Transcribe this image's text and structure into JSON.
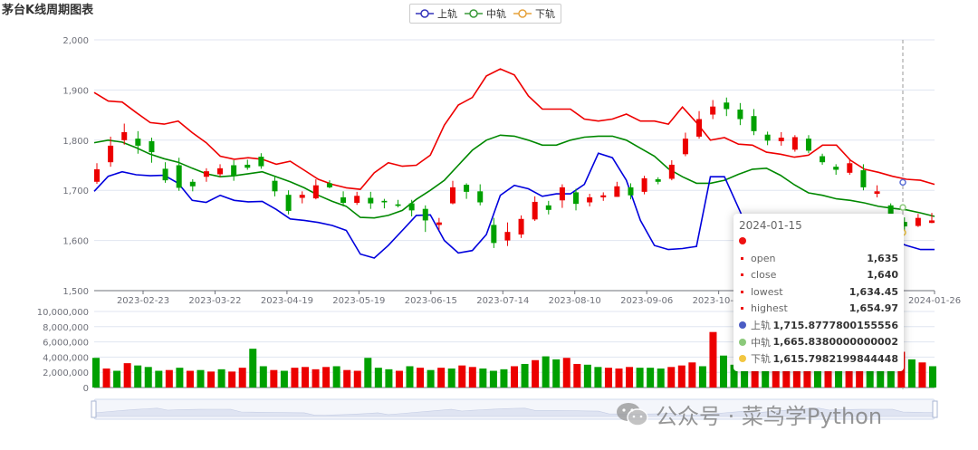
{
  "title": "茅台K线周期图表",
  "legend": [
    {
      "name": "上轨",
      "color": "#3333bb"
    },
    {
      "name": "中轨",
      "color": "#3a9a3a"
    },
    {
      "name": "下轨",
      "color": "#e6a23c"
    }
  ],
  "chart_data": [
    {
      "type": "candlestick",
      "subtype": "bollinger",
      "title": "茅台K线周期图表",
      "ylim": [
        1500,
        2000
      ],
      "yticks": [
        "1,500",
        "1,600",
        "1,700",
        "1,800",
        "1,900",
        "2,000"
      ],
      "xticks": [
        "2023-02-23",
        "2023-03-22",
        "2023-04-19",
        "2023-05-19",
        "2023-06-15",
        "2023-07-14",
        "2023-08-10",
        "2023-09-06",
        "2023-10-11",
        "2023-11-07",
        "2023-12-05",
        "2024-01-26"
      ],
      "colors": {
        "up": "#ec0000",
        "down": "#00a000",
        "upper": "#ee0000",
        "middle": "#008800",
        "lower": "#0000dd"
      },
      "upper": [
        1895,
        1878,
        1876,
        1855,
        1835,
        1832,
        1838,
        1815,
        1795,
        1768,
        1762,
        1765,
        1762,
        1752,
        1758,
        1740,
        1722,
        1712,
        1705,
        1702,
        1735,
        1755,
        1748,
        1750,
        1770,
        1830,
        1870,
        1885,
        1928,
        1942,
        1930,
        1888,
        1862,
        1862,
        1862,
        1842,
        1838,
        1842,
        1852,
        1838,
        1838,
        1832,
        1866,
        1835,
        1800,
        1805,
        1792,
        1790,
        1776,
        1772,
        1766,
        1770,
        1790,
        1790,
        1760,
        1742,
        1736,
        1728,
        1722,
        1720,
        1712
      ],
      "middle": [
        1795,
        1800,
        1796,
        1785,
        1772,
        1763,
        1756,
        1744,
        1733,
        1727,
        1729,
        1733,
        1737,
        1727,
        1717,
        1705,
        1690,
        1678,
        1668,
        1646,
        1645,
        1650,
        1660,
        1682,
        1700,
        1720,
        1750,
        1780,
        1800,
        1810,
        1808,
        1800,
        1790,
        1790,
        1800,
        1806,
        1808,
        1808,
        1800,
        1784,
        1768,
        1743,
        1727,
        1714,
        1714,
        1720,
        1732,
        1742,
        1744,
        1730,
        1711,
        1695,
        1690,
        1683,
        1680,
        1675,
        1668,
        1664,
        1661,
        1655,
        1648
      ],
      "lower": [
        1698,
        1728,
        1737,
        1731,
        1729,
        1730,
        1714,
        1680,
        1676,
        1690,
        1680,
        1677,
        1678,
        1662,
        1643,
        1640,
        1636,
        1630,
        1620,
        1573,
        1565,
        1590,
        1620,
        1650,
        1651,
        1600,
        1575,
        1580,
        1612,
        1690,
        1710,
        1703,
        1688,
        1693,
        1693,
        1712,
        1774,
        1765,
        1720,
        1640,
        1590,
        1582,
        1584,
        1588,
        1727,
        1727,
        1665,
        1603,
        1593,
        1600,
        1605,
        1610,
        1612,
        1606,
        1604,
        1619,
        1605,
        1600,
        1590,
        1582,
        1582
      ],
      "candles": [
        [
          1717,
          1742,
          1754,
          1713
        ],
        [
          1756,
          1789,
          1807,
          1747
        ],
        [
          1800,
          1816,
          1833,
          1791
        ],
        [
          1803,
          1789,
          1818,
          1773
        ],
        [
          1798,
          1776,
          1805,
          1755
        ],
        [
          1743,
          1720,
          1756,
          1715
        ],
        [
          1750,
          1705,
          1765,
          1699
        ],
        [
          1717,
          1708,
          1722,
          1698
        ],
        [
          1727,
          1738,
          1744,
          1717
        ],
        [
          1732,
          1744,
          1752,
          1727
        ],
        [
          1750,
          1729,
          1760,
          1719
        ],
        [
          1751,
          1745,
          1761,
          1741
        ],
        [
          1767,
          1748,
          1774,
          1743
        ],
        [
          1719,
          1698,
          1728,
          1688
        ],
        [
          1691,
          1659,
          1700,
          1652
        ],
        [
          1685,
          1691,
          1698,
          1674
        ],
        [
          1684,
          1710,
          1722,
          1682
        ],
        [
          1714,
          1706,
          1720,
          1704
        ],
        [
          1686,
          1675,
          1698,
          1668
        ],
        [
          1675,
          1689,
          1697,
          1671
        ],
        [
          1685,
          1674,
          1697,
          1663
        ],
        [
          1679,
          1676,
          1683,
          1664
        ],
        [
          1672,
          1669,
          1681,
          1666
        ],
        [
          1674,
          1660,
          1681,
          1648
        ],
        [
          1663,
          1640,
          1670,
          1617
        ],
        [
          1631,
          1636,
          1645,
          1621
        ],
        [
          1674,
          1706,
          1719,
          1672
        ],
        [
          1711,
          1697,
          1714,
          1683
        ],
        [
          1698,
          1676,
          1712,
          1670
        ],
        [
          1631,
          1595,
          1645,
          1585
        ],
        [
          1600,
          1617,
          1636,
          1589
        ],
        [
          1612,
          1643,
          1650,
          1605
        ],
        [
          1642,
          1677,
          1688,
          1639
        ],
        [
          1670,
          1661,
          1679,
          1652
        ],
        [
          1680,
          1706,
          1712,
          1665
        ],
        [
          1696,
          1673,
          1703,
          1660
        ],
        [
          1676,
          1686,
          1693,
          1668
        ],
        [
          1686,
          1690,
          1696,
          1679
        ],
        [
          1687,
          1708,
          1717,
          1687
        ],
        [
          1706,
          1690,
          1714,
          1682
        ],
        [
          1697,
          1724,
          1729,
          1692
        ],
        [
          1722,
          1717,
          1726,
          1712
        ],
        [
          1723,
          1751,
          1760,
          1720
        ],
        [
          1772,
          1803,
          1815,
          1768
        ],
        [
          1807,
          1842,
          1858,
          1803
        ],
        [
          1851,
          1867,
          1880,
          1842
        ],
        [
          1875,
          1862,
          1885,
          1848
        ],
        [
          1861,
          1842,
          1874,
          1830
        ],
        [
          1848,
          1818,
          1862,
          1810
        ],
        [
          1811,
          1799,
          1817,
          1790
        ],
        [
          1798,
          1805,
          1816,
          1789
        ],
        [
          1781,
          1806,
          1810,
          1777
        ],
        [
          1803,
          1779,
          1810,
          1774
        ],
        [
          1768,
          1756,
          1773,
          1751
        ],
        [
          1747,
          1741,
          1752,
          1731
        ],
        [
          1735,
          1754,
          1762,
          1731
        ],
        [
          1740,
          1706,
          1752,
          1700
        ],
        [
          1693,
          1698,
          1710,
          1686
        ],
        [
          1670,
          1635,
          1674,
          1629
        ],
        [
          1637,
          1628,
          1646,
          1621
        ],
        [
          1629,
          1645,
          1653,
          1627
        ],
        [
          1635,
          1640,
          1654.97,
          1634.45
        ]
      ]
    },
    {
      "type": "bar",
      "title": "volume",
      "ylim": [
        0,
        10000000
      ],
      "yticks": [
        "0",
        "2,000,000",
        "4,000,000",
        "6,000,000",
        "8,000,000",
        "10,000,000"
      ],
      "values": [
        3900000,
        2500000,
        2200000,
        3200000,
        2900000,
        2700000,
        2200000,
        2300000,
        2600000,
        2200000,
        2300000,
        2100000,
        2400000,
        2100000,
        2600000,
        5100000,
        2800000,
        2300000,
        2200000,
        2600000,
        2700000,
        2400000,
        2700000,
        2800000,
        2300000,
        2200000,
        3900000,
        2600000,
        2400000,
        2200000,
        2800000,
        2600000,
        2300000,
        2600000,
        2500000,
        2900000,
        2700000,
        2500000,
        2200000,
        2400000,
        2800000,
        3100000,
        3600000,
        4100000,
        3700000,
        3900000,
        3100000,
        3000000,
        2700000,
        2600000,
        2500000,
        2700000,
        2600000,
        2600000,
        2500000,
        2700000,
        2900000,
        3300000,
        2800000,
        7300000,
        4200000,
        3000000,
        2700000,
        2600000,
        2800000,
        3300000,
        9200000,
        3100000,
        2900000,
        2700000,
        2800000,
        2600000,
        2600000,
        2700000,
        3300000,
        5300000,
        4800000,
        4700000,
        3700000,
        3300000,
        2800000
      ],
      "colors": {
        "up": "#ec0000",
        "down": "#00a000"
      }
    }
  ],
  "tooltip": {
    "date": "2024-01-15",
    "rows": [
      {
        "label": "open",
        "value": "1,635"
      },
      {
        "label": "close",
        "value": "1,640"
      },
      {
        "label": "lowest",
        "value": "1,634.45"
      },
      {
        "label": "highest",
        "value": "1,654.97"
      }
    ],
    "series": [
      {
        "label": "上轨",
        "value": "1,715.8777800155556",
        "color": "#4b5cc4"
      },
      {
        "label": "中轨",
        "value": "1,665.8380000000002",
        "color": "#8bc97a"
      },
      {
        "label": "下轨",
        "value": "1,615.7982199844448",
        "color": "#f2c641"
      }
    ]
  },
  "watermark": "公众号 · 菜鸟学Python"
}
